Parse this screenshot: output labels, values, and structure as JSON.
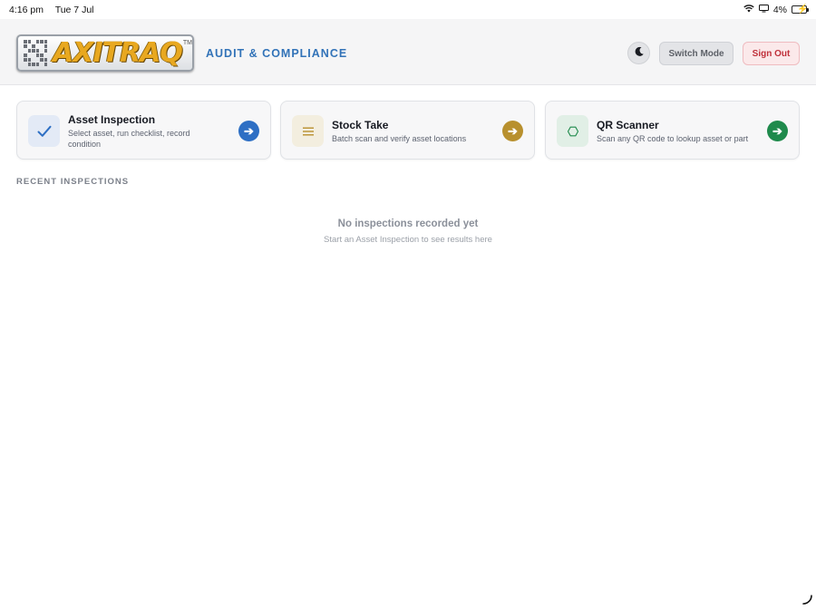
{
  "status_bar": {
    "time": "4:16 pm",
    "date": "Tue 7 Jul",
    "battery": "4%"
  },
  "header": {
    "logo_text": "AXITRAQ",
    "logo_tm": "TM",
    "subtitle": "AUDIT & COMPLIANCE",
    "switch_mode_label": "Switch Mode",
    "sign_out_label": "Sign Out"
  },
  "cards": [
    {
      "title": "Asset Inspection",
      "description": "Select asset, run checklist, record condition",
      "icon": "check-icon",
      "accent": "#2e6fc4",
      "icon_bg": "#e3eaf6"
    },
    {
      "title": "Stock Take",
      "description": "Batch scan and verify asset locations",
      "icon": "list-icon",
      "accent": "#b8902e",
      "icon_bg": "#f3eedf"
    },
    {
      "title": "QR Scanner",
      "description": "Scan any QR code to lookup asset or part",
      "icon": "hexagon-icon",
      "accent": "#1f8a4c",
      "icon_bg": "#e1efe6"
    }
  ],
  "recent": {
    "heading": "RECENT INSPECTIONS",
    "empty_title": "No inspections recorded yet",
    "empty_subtitle": "Start an Asset Inspection to see results here"
  }
}
